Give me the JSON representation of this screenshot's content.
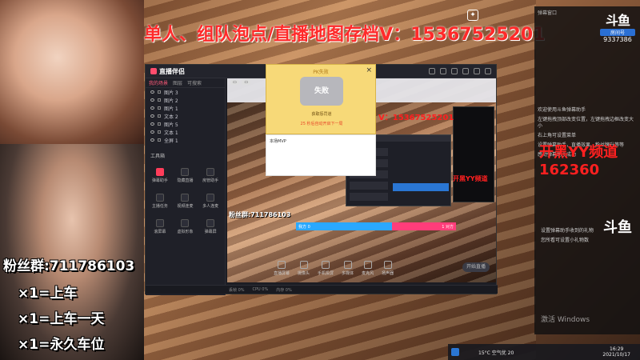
{
  "overlay": {
    "title": "单人、组队泡点/直播地图存档V：15367525201",
    "fans_group": "粉丝群:711786103",
    "car1": "×1=上车",
    "car2": "×1=上车一天",
    "car3": "×1=永久车位"
  },
  "chat": {
    "header_left": "弹幕窗口",
    "logo_name": "斗鱼",
    "room_label": "房间号",
    "room_number": "9337386",
    "lines": [
      "欢迎使用斗鱼弹幕助手",
      "左键拖拽顶部改变位置，左键拖拽边框改变大小",
      "右上角可设置菜单",
      "设置弹幕助手，直播效果、粉丝牌升等等",
      "感动弹幕助手成功"
    ],
    "yy_text": "开黑YY频道",
    "yy_number": "162360",
    "bottom_lines": [
      "设置弹幕助手收到的礼物",
      "您所看可设置小礼物数"
    ],
    "watermark": "激活 Windows"
  },
  "window": {
    "brand": "直播伴侣",
    "tabs": [
      "我的场景",
      "图层",
      "可搜索"
    ],
    "scenes": [
      "图片 3",
      "图片 2",
      "图片 1",
      "文本 2",
      "图片 5",
      "文本 1",
      "全屏 1"
    ],
    "tools_title": "工具箱",
    "tools": [
      {
        "label": "弹幕助手"
      },
      {
        "label": "隐藏直播"
      },
      {
        "label": "房管助手"
      },
      {
        "label": "主播任务"
      },
      {
        "label": "视频连麦"
      },
      {
        "label": "多人连麦"
      },
      {
        "label": "滚屏幕"
      },
      {
        "label": "虚拟形象"
      },
      {
        "label": "弹幕屏"
      },
      {
        "label": "直播录制"
      },
      {
        "label": "摄像头"
      },
      {
        "label": "更多"
      }
    ],
    "bottom_actions": [
      "直播屏幕",
      "摄像头",
      "手机投屏",
      "多媒体",
      "麦克风",
      "扬声器"
    ],
    "live_btn": "开始直播",
    "statusbar": [
      "丢帧 0%",
      "CPU 0%",
      "内存 0%"
    ],
    "preview_inner_title": "开黑YY频道",
    "pk_left": "我方 0",
    "pk_right": "1 对方"
  },
  "popup": {
    "title": "PK失败",
    "badge": "失败",
    "line1": "获取惩罚道",
    "line2": "25 秒后自动开启下一局",
    "phone": "V：15367525201",
    "mvp_label": "本场MVP"
  },
  "taskbar": {
    "weather": "15°C 空气优 20",
    "time": "16:29",
    "date": "2021/10/17"
  }
}
